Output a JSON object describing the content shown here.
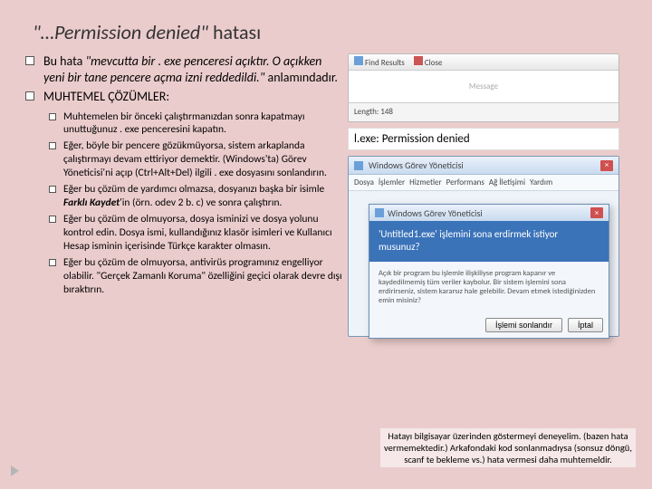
{
  "title_quote": "\"…Permission denied\"",
  "title_rest": " hatası",
  "outer1_lead": "Bu hata ",
  "outer1_ital1": "\"mevcutta bir . exe penceresi açıktır. O açıkken yeni bir tane pencere açma izni reddedildi.\"",
  "outer1_tail": " anlamındadır.",
  "outer2": "MUHTEMEL ÇÖZÜMLER:",
  "inner": [
    "Muhtemelen bir önceki çalıştırmanızdan sonra kapatmayı unuttuğunuz . exe penceresini kapatın.",
    "Eğer, böyle bir pencere gözükmüyorsa, sistem arkaplanda çalıştırmayı devam ettiriyor demektir. (Windows'ta) Görev Yöneticisi'ni açıp (Ctrl+Alt+Del) ilgili . exe dosyasını sonlandırın.",
    "Eğer bu çözüm de yardımcı olmazsa, dosyanızı başka bir isimle Farklı Kaydet'in (örn. odev 2 b. c) ve sonra çalıştırın.",
    "Eğer bu çözüm de olmuyorsa, dosya isminizi ve dosya yolunu kontrol edin. Dosya ismi, kullandığınız klasör isimleri ve Kullanıcı Hesap isminin içerisinde Türkçe karakter olmasın.",
    "Eğer bu çözüm  de olmuyorsa, antivirüs programınız engelliyor olabilir. \"Gerçek Zamanlı Koruma\" özelliğini geçici olarak devre dışı bıraktırın."
  ],
  "screenshot_top": {
    "find": "Find Results",
    "close": "Close",
    "mid": "Message",
    "length": "Length: 148"
  },
  "perm_line": "l.exe: Permission denied",
  "taskmgr": {
    "title": "Windows Görev Yöneticisi",
    "tabs": [
      "Dosya",
      "İşlemler",
      "Hizmetler",
      "Performans",
      "Ağ İletişimi",
      "Yardım"
    ],
    "inner_title": "Windows Görev Yöneticisi",
    "question": "'Untitled1.exe' işlemini sona erdirmek istiyor musunuz?",
    "body": "Açık bir program bu işlemle ilişkiliyse program kapanır ve kaydedilmemiş tüm veriler kaybolur. Bir sistem işlemini sona erdirirseniz, sistem kararsız hale gelebilir. Devam etmek istediğinizden emin misiniz?",
    "ok": "İşlemi sonlandır",
    "cancel": "İptal"
  },
  "note": "Hatayı bilgisayar üzerinden göstermeyi deneyelim. (bazen hata vermemektedir.) Arkafondaki kod sonlanmadıysa (sonsuz döngü, scanf te bekleme vs.) hata vermesi daha muhtemeldir."
}
